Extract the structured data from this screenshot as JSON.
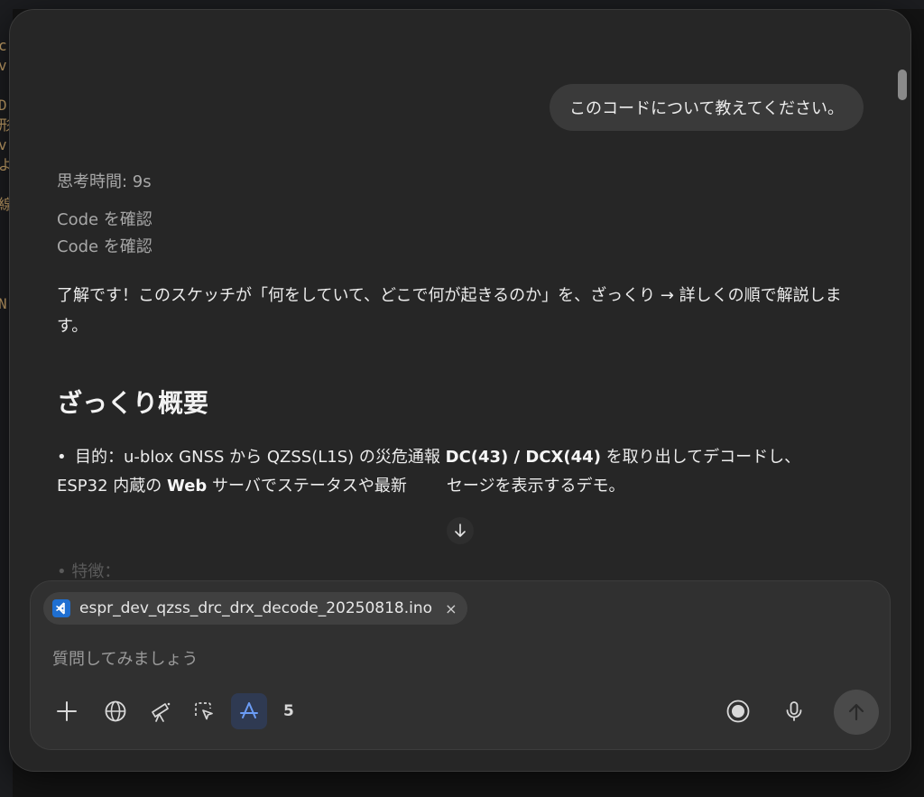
{
  "backdrop": {
    "glyphs": "c\nv\n\nD\n形\nv\nよ\n\n線\n\n\n\n\nN"
  },
  "conversation": {
    "user_message": "このコードについて教えてください。",
    "thinking_time": "思考時間: 9s",
    "steps": [
      "Code を確認",
      "Code を確認"
    ],
    "intro": "了解です！このスケッチが「何をしていて、どこで何が起きるのか」を、ざっくり → 詳しくの順で解説します。",
    "heading": "ざっくり概要",
    "bullet": {
      "marker": "•",
      "part1": "目的：u-blox GNSS から QZSS(L1S) の災危通報 ",
      "bold1": "DC(43) / DCX(44)",
      "part2": " を取り出してデコードし、",
      "part3": "ESP32 内蔵の ",
      "bold2": "Web",
      "part4": " サーバでステータスや最新",
      "part5": "セージを表示するデモ。"
    },
    "next_bullet_faded": "• 特徴："
  },
  "composer": {
    "attached_file": "espr_dev_qzss_drc_drx_decode_20250818.ino",
    "chip_close": "×",
    "placeholder": "質問してみましょう",
    "tools_count": "5"
  },
  "icons": {
    "attach": "plus-icon",
    "web": "globe-icon",
    "research": "telescope-icon",
    "canvas": "cursor-select-icon",
    "active_tool": "app-store-icon",
    "voice_mode": "record-icon",
    "dictate": "microphone-icon",
    "send": "arrow-up-icon",
    "scroll": "arrow-down-icon"
  },
  "colors": {
    "window_bg": "#262626",
    "accent": "#6b9cf5",
    "bubble_bg": "#3a3a3a"
  }
}
